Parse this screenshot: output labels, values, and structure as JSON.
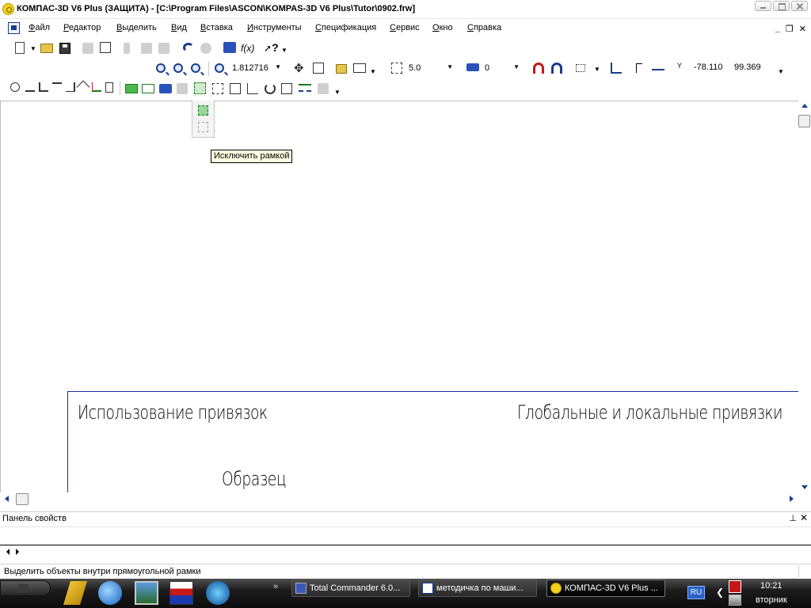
{
  "window": {
    "title": "КОМПАС-3D V6 Plus (ЗАЩИТА) - [C:\\Program Files\\ASCON\\KOMPAS-3D V6 Plus\\Tutor\\0902.frw]"
  },
  "menu": {
    "items": [
      "Файл",
      "Редактор",
      "Выделить",
      "Вид",
      "Вставка",
      "Инструменты",
      "Спецификация",
      "Сервис",
      "Окно",
      "Справка"
    ],
    "mdi_min": "_",
    "mdi_restore": "❐",
    "mdi_close": "✕"
  },
  "toolbar": {
    "fx_label": "f(x)",
    "help_label": "?",
    "zoom_value": "1.812716",
    "step_value": "5.0",
    "layer_value": "0",
    "coord_label": "Y",
    "coord_x": "-78.110",
    "coord_y": "99.369"
  },
  "canvas": {
    "text_left": "Использование привязок",
    "text_right": "Глобальные и локальные привязки",
    "text_sample": "Образец"
  },
  "tooltip": {
    "text": "Исключить рамкой"
  },
  "properties": {
    "header": "Панель свойств",
    "pin": "⊥",
    "close": "✕"
  },
  "status": {
    "text": "Выделить объекты внутри прямоугольной рамки"
  },
  "taskbar": {
    "more": "»",
    "tasks": [
      {
        "label": "Total Commander 6.0..."
      },
      {
        "label": "методичка по маши..."
      },
      {
        "label": "КОМПАС-3D V6 Plus ..."
      }
    ],
    "tray": {
      "lang": "RU",
      "time": "10:21",
      "day": "вторник"
    }
  },
  "colors": {
    "frame_line": "#1c2ca0",
    "tooltip_bg": "#ffffe1",
    "accent_blue": "#1c3c8c"
  }
}
